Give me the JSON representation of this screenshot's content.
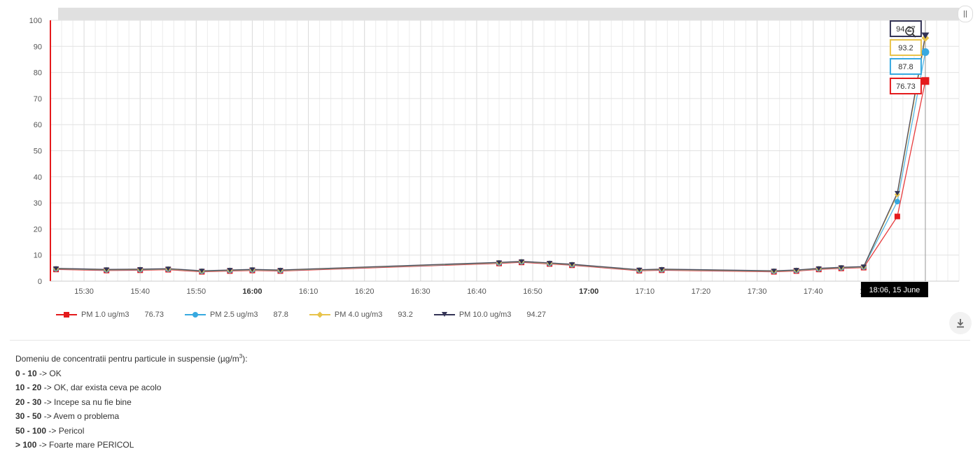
{
  "chart_data": {
    "type": "line",
    "ylim": [
      0,
      100
    ],
    "y_ticks": [
      0,
      10,
      20,
      30,
      40,
      50,
      60,
      70,
      80,
      90,
      100
    ],
    "x_ticks": [
      {
        "label": "15:30",
        "x": 15.5,
        "bold": false
      },
      {
        "label": "15:40",
        "x": 15.6667,
        "bold": false
      },
      {
        "label": "15:50",
        "x": 15.8333,
        "bold": false
      },
      {
        "label": "16:00",
        "x": 16.0,
        "bold": true
      },
      {
        "label": "16:10",
        "x": 16.1667,
        "bold": false
      },
      {
        "label": "16:20",
        "x": 16.3333,
        "bold": false
      },
      {
        "label": "16:30",
        "x": 16.5,
        "bold": false
      },
      {
        "label": "16:40",
        "x": 16.6667,
        "bold": false
      },
      {
        "label": "16:50",
        "x": 16.8333,
        "bold": false
      },
      {
        "label": "17:00",
        "x": 17.0,
        "bold": true
      },
      {
        "label": "17:10",
        "x": 17.1667,
        "bold": false
      },
      {
        "label": "17:20",
        "x": 17.3333,
        "bold": false
      },
      {
        "label": "17:30",
        "x": 17.5,
        "bold": false
      },
      {
        "label": "17:40",
        "x": 17.6667,
        "bold": false
      },
      {
        "label": "17:50",
        "x": 17.8333,
        "bold": false
      }
    ],
    "xlim": [
      15.4,
      18.1
    ],
    "x": [
      15.4167,
      15.5667,
      15.6667,
      15.75,
      15.85,
      15.9333,
      16.0,
      16.0833,
      16.7333,
      16.8,
      16.8833,
      16.95,
      17.15,
      17.2167,
      17.55,
      17.6167,
      17.6833,
      17.75,
      17.8167,
      17.9167,
      18.0
    ],
    "series": [
      {
        "name": "PM 1.0 ug/m3",
        "value_label": "76.73",
        "color": "#e41a1c",
        "marker": "square",
        "values": [
          4.5,
          4.1,
          4.2,
          4.4,
          3.6,
          3.9,
          4.1,
          3.9,
          6.8,
          7.2,
          6.6,
          6.1,
          4.0,
          4.2,
          3.6,
          3.9,
          4.5,
          4.9,
          5.2,
          24.8,
          76.73
        ]
      },
      {
        "name": "PM 2.5 ug/m3",
        "value_label": "87.8",
        "color": "#37a9e0",
        "marker": "circle",
        "values": [
          4.7,
          4.3,
          4.4,
          4.6,
          3.8,
          4.1,
          4.3,
          4.1,
          7.0,
          7.4,
          6.8,
          6.3,
          4.2,
          4.4,
          3.8,
          4.1,
          4.7,
          5.1,
          5.4,
          30.5,
          87.8
        ]
      },
      {
        "name": "PM 4.0 ug/m3",
        "value_label": "93.2",
        "color": "#e8c34a",
        "marker": "diamond",
        "values": [
          4.8,
          4.4,
          4.5,
          4.7,
          3.9,
          4.2,
          4.4,
          4.2,
          7.1,
          7.5,
          6.9,
          6.4,
          4.3,
          4.5,
          3.9,
          4.2,
          4.8,
          5.2,
          5.5,
          33.2,
          93.2
        ]
      },
      {
        "name": "PM 10.0 ug/m3",
        "value_label": "94.27",
        "color": "#333355",
        "marker": "triangle-down",
        "values": [
          4.9,
          4.5,
          4.6,
          4.8,
          4.0,
          4.3,
          4.5,
          4.3,
          7.2,
          7.6,
          7.0,
          6.5,
          4.4,
          4.6,
          4.0,
          4.3,
          4.9,
          5.3,
          5.6,
          33.8,
          94.27
        ]
      }
    ],
    "crosshair_label": "18:06, 15 June",
    "grid": true,
    "legend_position": "bottom-left"
  },
  "controls": {
    "zoom_out_icon": "zoom-out-icon",
    "download_icon": "download-icon",
    "scrollbar_handle_icon": "grip-icon"
  },
  "info": {
    "title_main": "Domeniu de concentratii pentru particule in suspensie (µg/m",
    "title_sup": "3",
    "title_end": "):",
    "rows": [
      {
        "range": "0 - 10",
        "text": " -> OK"
      },
      {
        "range": "10 - 20",
        "text": " -> OK, dar exista ceva pe acolo"
      },
      {
        "range": "20 - 30",
        "text": " -> Incepe sa nu fie bine"
      },
      {
        "range": "30 - 50",
        "text": " -> Avem o problema"
      },
      {
        "range": "50 - 100",
        "text": " -> Pericol"
      },
      {
        "range": "> 100",
        "text": " -> Foarte mare PERICOL"
      }
    ]
  }
}
